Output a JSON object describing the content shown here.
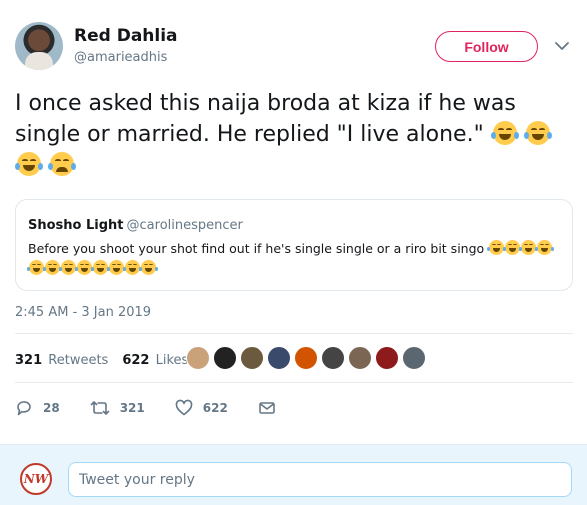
{
  "author": {
    "display_name": "Red Dahlia",
    "handle": "@amarieadhis"
  },
  "follow_label": "Follow",
  "tweet": {
    "text": "I once asked this naija broda at kiza if he was single or married. He replied \"I live alone.\"",
    "timestamp": "2:45 AM - 3 Jan 2019"
  },
  "quoted_tweet": {
    "display_name": "Shosho Light",
    "handle": "@carolinespencer",
    "text": "Before you shoot your shot find out if he's single single or a riro bit singo"
  },
  "stats": {
    "retweets_count": "321",
    "retweets_label": "Retweets",
    "likes_count": "622",
    "likes_label": "Likes"
  },
  "actions": {
    "replies": "28",
    "retweets": "321",
    "likes": "622"
  },
  "reply": {
    "avatar_text": "NW",
    "placeholder": "Tweet your reply"
  },
  "colors": {
    "follow_accent": "#e0245e",
    "secondary_text": "#657786",
    "reply_bg": "#e8f5fd"
  }
}
